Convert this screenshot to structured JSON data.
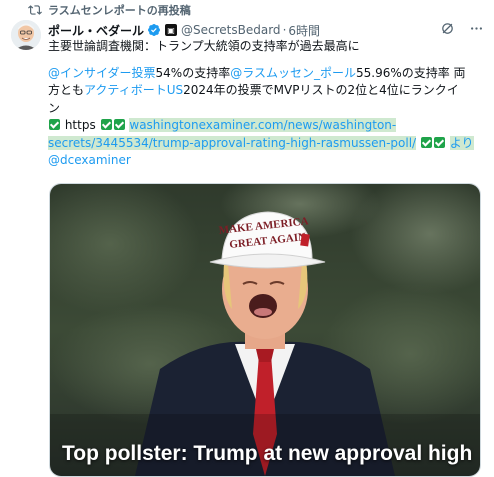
{
  "repost": {
    "text": "ラスムセンレポートの再投稿",
    "icon": "repost-icon"
  },
  "author": {
    "name": "ポール・ベダール",
    "handle": "@SecretsBedard",
    "separator": "·",
    "time": "6時間",
    "verified_color": "#1d9bf0"
  },
  "tweet": {
    "line1": "主要世論調査機関：トランプ大統領の支持率が過去最高に",
    "line2_mention1": "@インサイダー投票",
    "line2_text1": "54%の支持率",
    "line2_mention2": "@ラスムッセン_ポール",
    "line2_text2": "55.96%の支持率 両",
    "line3_text1": "方とも",
    "line3_mention": "アクティボートUS",
    "line3_text2": "2024年の投票でMVPリストの2位と4位にランクイ",
    "line4": "ン",
    "https_text": "https",
    "link_part1": "washingtonexaminer.com/news/washington-",
    "link_part2": "secrets/3445534/trump-approval-rating-high-rasmussen-poll/",
    "yori": "より",
    "via_handle": "@dcexaminer"
  },
  "media": {
    "caption": "Top pollster: Trump at new approval high",
    "hat_line1": "MAKE AMERICA",
    "hat_line2": "GREAT AGAIN"
  },
  "colors": {
    "accent": "#1d9bf0",
    "highlight": "#cfe9d0",
    "check_green": "#1fa34a"
  }
}
